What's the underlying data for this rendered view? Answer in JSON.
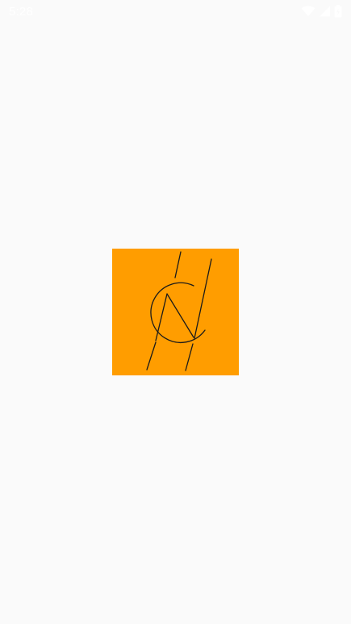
{
  "status_bar": {
    "time": "5:28",
    "icons": [
      "wifi-icon",
      "cell-signal-icon",
      "battery-icon"
    ],
    "icon_color": "#ffffff"
  },
  "splash": {
    "logo": "app-logo",
    "background_color": "#ff9d00",
    "stroke_color": "#1a1a1a"
  },
  "colors": {
    "page_background": "#fafafa"
  }
}
